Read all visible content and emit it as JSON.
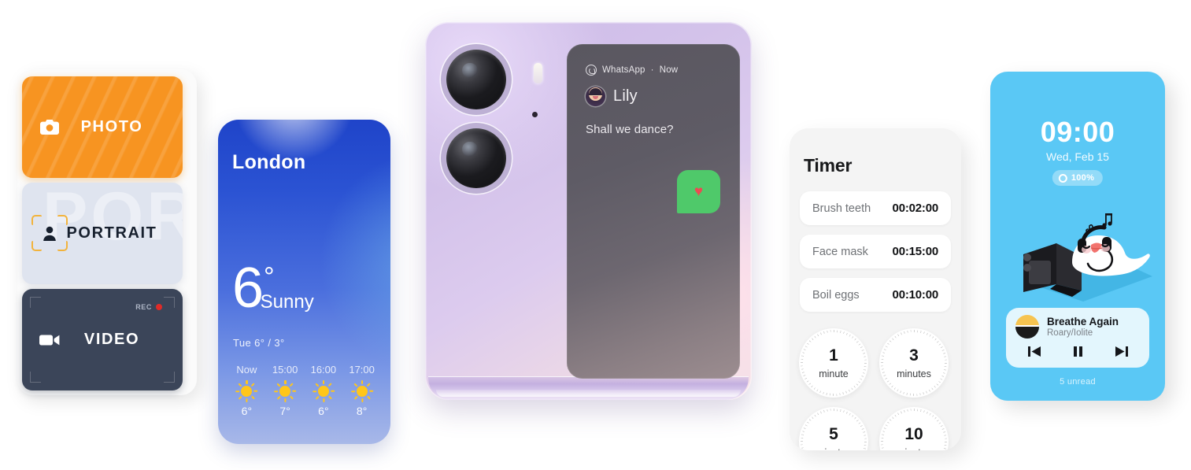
{
  "camera_modes": {
    "items": [
      {
        "id": "photo",
        "label": "PHOTO",
        "icon": "camera-icon"
      },
      {
        "id": "portrait",
        "label": "PORTRAIT",
        "icon": "person-focus-icon",
        "watermark": "POR"
      },
      {
        "id": "video",
        "label": "VIDEO",
        "icon": "video-camera-icon",
        "rec_label": "REC"
      }
    ],
    "colors": {
      "photo_bg": "#f79421",
      "portrait_bg": "#dfe4ef",
      "video_bg": "#3b4559",
      "rec_dot": "#e02b28"
    }
  },
  "weather": {
    "city": "London",
    "temperature": "6",
    "degree_symbol": "°",
    "condition": "Sunny",
    "range": "Tue  6° / 3°",
    "hourly": [
      {
        "time": "Now",
        "icon": "sun-icon",
        "temp": "6°"
      },
      {
        "time": "15:00",
        "icon": "sun-icon",
        "temp": "7°"
      },
      {
        "time": "16:00",
        "icon": "sun-icon",
        "temp": "6°"
      },
      {
        "time": "17:00",
        "icon": "sun-icon",
        "temp": "8°"
      }
    ],
    "colors": {
      "sky_top": "#1f44c9",
      "sky_bottom": "#a8b8e8",
      "sun": "#ffc61a"
    }
  },
  "phone": {
    "notification": {
      "app_name": "WhatsApp",
      "time": "Now",
      "separator": "·",
      "sender": "Lily",
      "message": "Shall we dance?",
      "sticker": "♥",
      "sticker_bg": "#4fc96a"
    },
    "body_color": "#d3c2ea",
    "cover_screen_color": "#6d6770"
  },
  "timer": {
    "title": "Timer",
    "rows": [
      {
        "name": "Brush teeth",
        "time": "00:02:00"
      },
      {
        "name": "Face mask",
        "time": "00:15:00"
      },
      {
        "name": "Boil eggs",
        "time": "00:10:00"
      }
    ],
    "presets": [
      {
        "value": "1",
        "unit": "minute"
      },
      {
        "value": "3",
        "unit": "minutes"
      },
      {
        "value": "5",
        "unit": "minutes"
      },
      {
        "value": "10",
        "unit": "minutes"
      }
    ],
    "card_bg": "#f4f4f4"
  },
  "clock_card": {
    "time": "09:00",
    "date": "Wed, Feb 15",
    "battery": "100%",
    "battery_icon": "battery-ring-icon",
    "illustration": "bird-with-headphones-and-flip-phone",
    "music": {
      "title": "Breathe Again",
      "artist": "Roary/Iolite",
      "previous_icon": "skip-previous-icon",
      "pause_icon": "pause-icon",
      "next_icon": "skip-next-icon"
    },
    "unread": "5 unread",
    "bg_color": "#5ac8f5",
    "widget_bg": "#e3f6fd"
  }
}
